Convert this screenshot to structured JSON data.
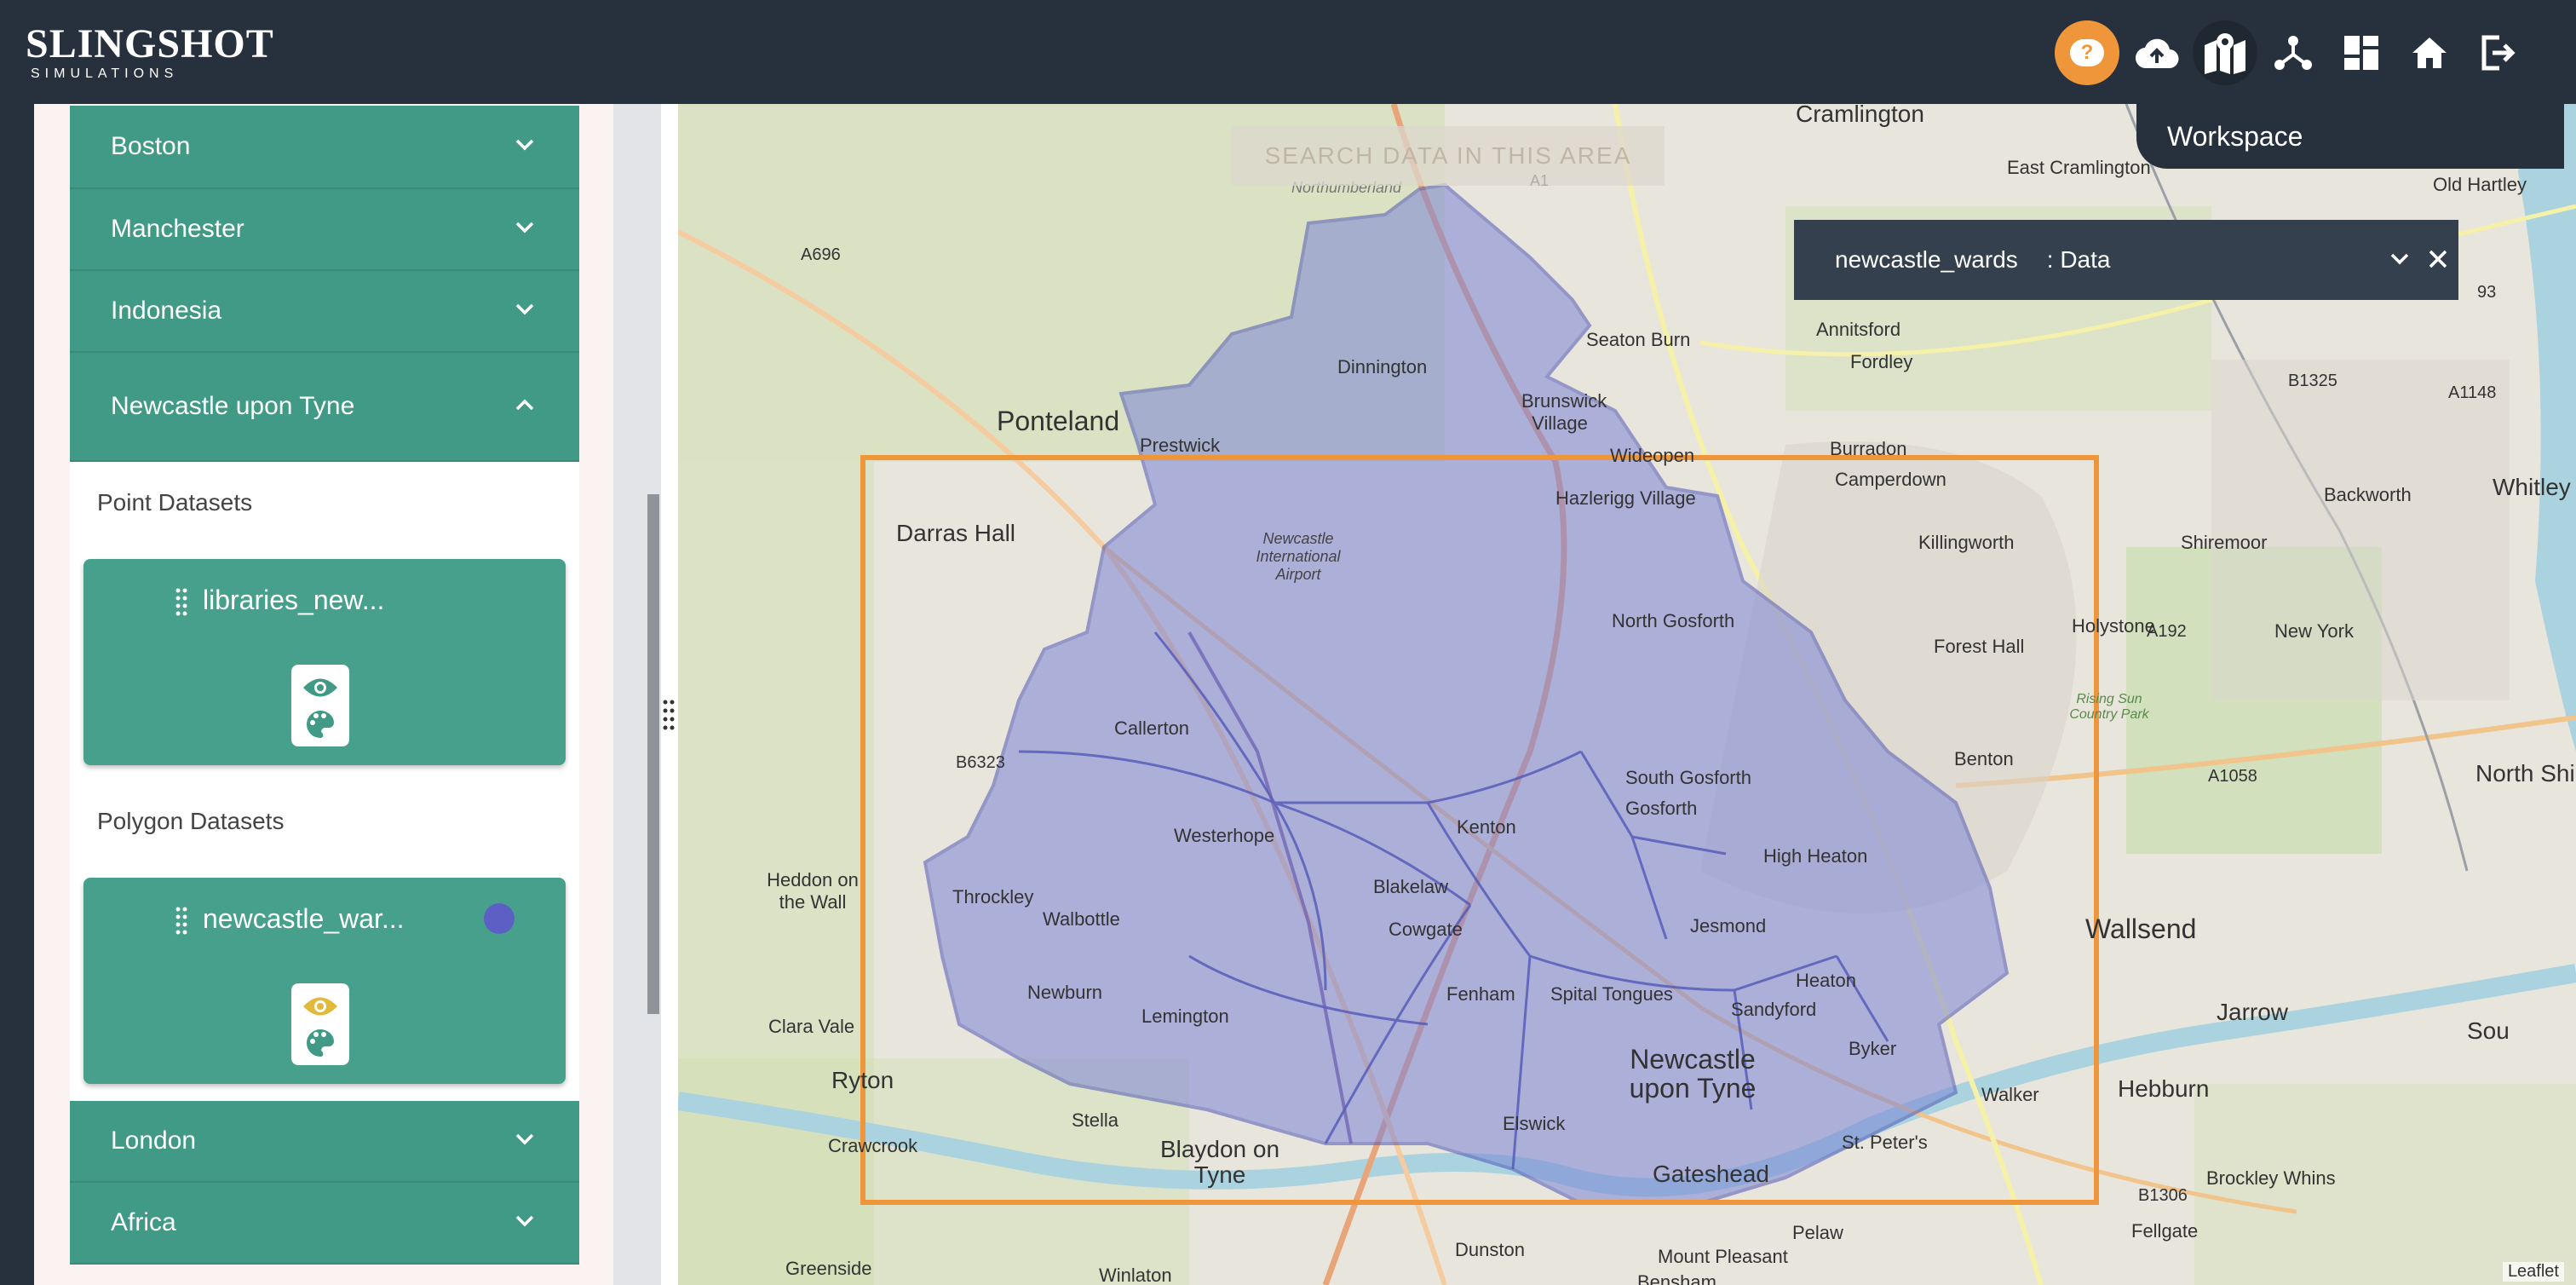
{
  "header": {
    "logo_main": "SLINGSHOT",
    "logo_sub": "SIMULATIONS",
    "tooltip": "Workspace",
    "icons": [
      "help-icon",
      "cloud-upload-icon",
      "map-icon",
      "network-icon",
      "dashboard-icon",
      "home-icon",
      "logout-icon"
    ]
  },
  "sidebar": {
    "accordions": [
      {
        "label": "Boston"
      },
      {
        "label": "Manchester"
      },
      {
        "label": "Indonesia"
      },
      {
        "label": "Newcastle upon Tyne",
        "expanded": true
      },
      {
        "label": "London"
      },
      {
        "label": "Africa"
      }
    ],
    "newcastle": {
      "point_label": "Point Datasets",
      "point_dataset": "libraries_new...",
      "polygon_label": "Polygon Datasets",
      "polygon_dataset": "newcastle_war...",
      "polygon_color": "#5e5fc4"
    }
  },
  "map": {
    "search_placeholder": "SEARCH DATA IN THIS AREA",
    "data_panel": {
      "dataset": "newcastle_wards",
      "suffix": ": Data"
    },
    "attribution": "Leaflet",
    "labels": {
      "cramlington": "Cramlington",
      "east_cramlington": "East Cramlington",
      "old_hartley": "Old Hartley",
      "northumberland": "Northumberland",
      "a1": "A1",
      "a696": "A696",
      "dinnington": "Dinnington",
      "seaton_burn": "Seaton Burn",
      "annitsford": "Annitsford",
      "fordley": "Fordley",
      "ponteland": "Ponteland",
      "prestwick": "Prestwick",
      "brunswick_village": "Brunswick Village",
      "widdrington": "Wideopen",
      "burradon": "Burradon",
      "camperdown": "Camperdown",
      "b1325": "B1325",
      "a1148": "A1148",
      "whitley_bay": "Whitley B",
      "darras_hall": "Darras Hall",
      "hazlerigg": "Hazlerigg Village",
      "killingworth": "Killingworth",
      "backworth": "Backworth",
      "shiremoor": "Shiremoor",
      "ncl_airport": "Newcastle International Airport",
      "north_gosforth": "North Gosforth",
      "holystone": "Holystone",
      "new_york": "New York",
      "a192": "A192",
      "forest_hall": "Forest Hall",
      "callerton": "Callerton",
      "rising_sun": "Rising Sun Country Park",
      "benton": "Benton",
      "a1058": "A1058",
      "north_shields": "North Shie",
      "b6323": "B6323",
      "south_gosforth": "South Gosforth",
      "gosforth": "Gosforth",
      "westerhope": "Westerhope",
      "kenton": "Kenton",
      "high_heaton": "High Heaton",
      "heddon": "Heddon on the Wall",
      "throckley": "Throckley",
      "walbottle": "Walbottle",
      "blakelaw": "Blakelaw",
      "cowgate": "Cowgate",
      "jesmond": "Jesmond",
      "wallsend": "Wallsend",
      "newburn": "Newburn",
      "lemington": "Lemington",
      "fenham": "Fenham",
      "spital_tongues": "Spital Tongues",
      "sandyford": "Sandyford",
      "heaton": "Heaton",
      "clara_vale": "Clara Vale",
      "jarrow": "Jarrow",
      "ryton": "Ryton",
      "newcastle": "Newcastle upon Tyne",
      "byker": "Byker",
      "walker": "Walker",
      "hebburn": "Hebburn",
      "crawcrook": "Crawcrook",
      "stella": "Stella",
      "blaydon": "Blaydon on Tyne",
      "elswick": "Elswick",
      "gateshead": "Gateshead",
      "st_peters": "St. Peter's",
      "b1306": "B1306",
      "brockley": "Brockley Whins",
      "fellgate": "Fellgate",
      "pelaw": "Pelaw",
      "greenside": "Greenside",
      "winlaton": "Winlaton",
      "dunston": "Dunston",
      "mount_pleasant": "Mount Pleasant",
      "bensham": "Bensham",
      "sou": "Sou",
      "a193": "93"
    }
  }
}
